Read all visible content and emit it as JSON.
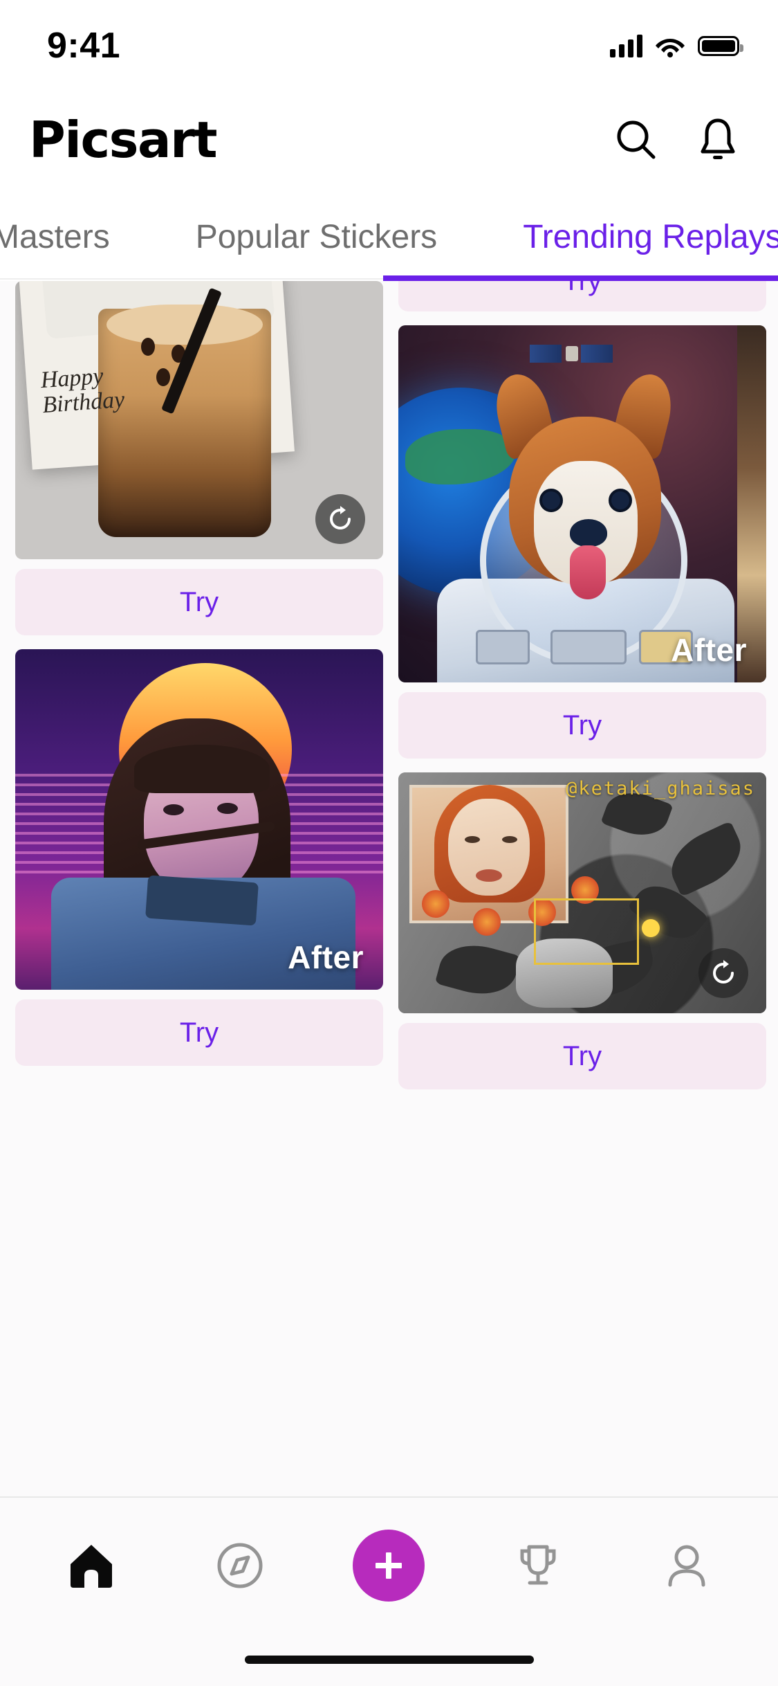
{
  "status_bar": {
    "time": "9:41",
    "signal_icon": "cellular-signal-icon",
    "wifi_icon": "wifi-icon",
    "battery_icon": "battery-icon"
  },
  "header": {
    "logo": "Picsart",
    "search_icon": "search-icon",
    "notifications_icon": "bell-icon"
  },
  "tabs": {
    "items": [
      {
        "label": "Masters",
        "active": false
      },
      {
        "label": "Popular Stickers",
        "active": false
      },
      {
        "label": "Trending Replays",
        "active": true
      }
    ],
    "active_index": 2,
    "active_color": "#6a20e8",
    "inactive_color": "#6e6e6e"
  },
  "feed": {
    "try_label": "Try",
    "after_label": "After",
    "replay_icon": "replay-icon",
    "left_column": [
      {
        "id": "birthday-coffee",
        "artwork": "happy-birthday-coffee-polaroid",
        "caption_overlay": "Happy\nBirthday",
        "has_replay_button": true,
        "has_after_label": false,
        "try_label": "Try"
      },
      {
        "id": "retro-sunset-portrait",
        "artwork": "retro-synthwave-sunset-girl",
        "has_replay_button": false,
        "has_after_label": true,
        "after_label": "After",
        "try_label": "Try"
      }
    ],
    "right_column": [
      {
        "id": "clipped-top-card",
        "artwork": "clipped-above-viewport",
        "try_label": "Try"
      },
      {
        "id": "astronaut-corgi",
        "artwork": "astronaut-corgi-in-space",
        "has_replay_button": false,
        "has_after_label": true,
        "after_label": "After",
        "try_label": "Try"
      },
      {
        "id": "flower-collage",
        "artwork": "monochrome-flower-collage-portrait",
        "watermark": "@ketaki_ghaisas",
        "watermark_color": "#e8c13c",
        "has_replay_button": true,
        "has_after_label": false,
        "try_label": "Try"
      }
    ],
    "try_button_bg": "#f6e9f2",
    "try_button_text_color": "#6a20e8"
  },
  "bottom_nav": {
    "items": [
      {
        "name": "home",
        "icon": "home-icon",
        "active": true
      },
      {
        "name": "explore",
        "icon": "compass-icon",
        "active": false
      },
      {
        "name": "create",
        "icon": "plus-icon",
        "active": false,
        "accent": "#b72bbd"
      },
      {
        "name": "challenges",
        "icon": "trophy-icon",
        "active": false
      },
      {
        "name": "profile",
        "icon": "person-icon",
        "active": false
      }
    ]
  },
  "colors": {
    "brand_purple": "#6a20e8",
    "fab_magenta": "#b72bbd",
    "feed_bg": "#fbfafb",
    "try_bg": "#f6e9f2"
  }
}
